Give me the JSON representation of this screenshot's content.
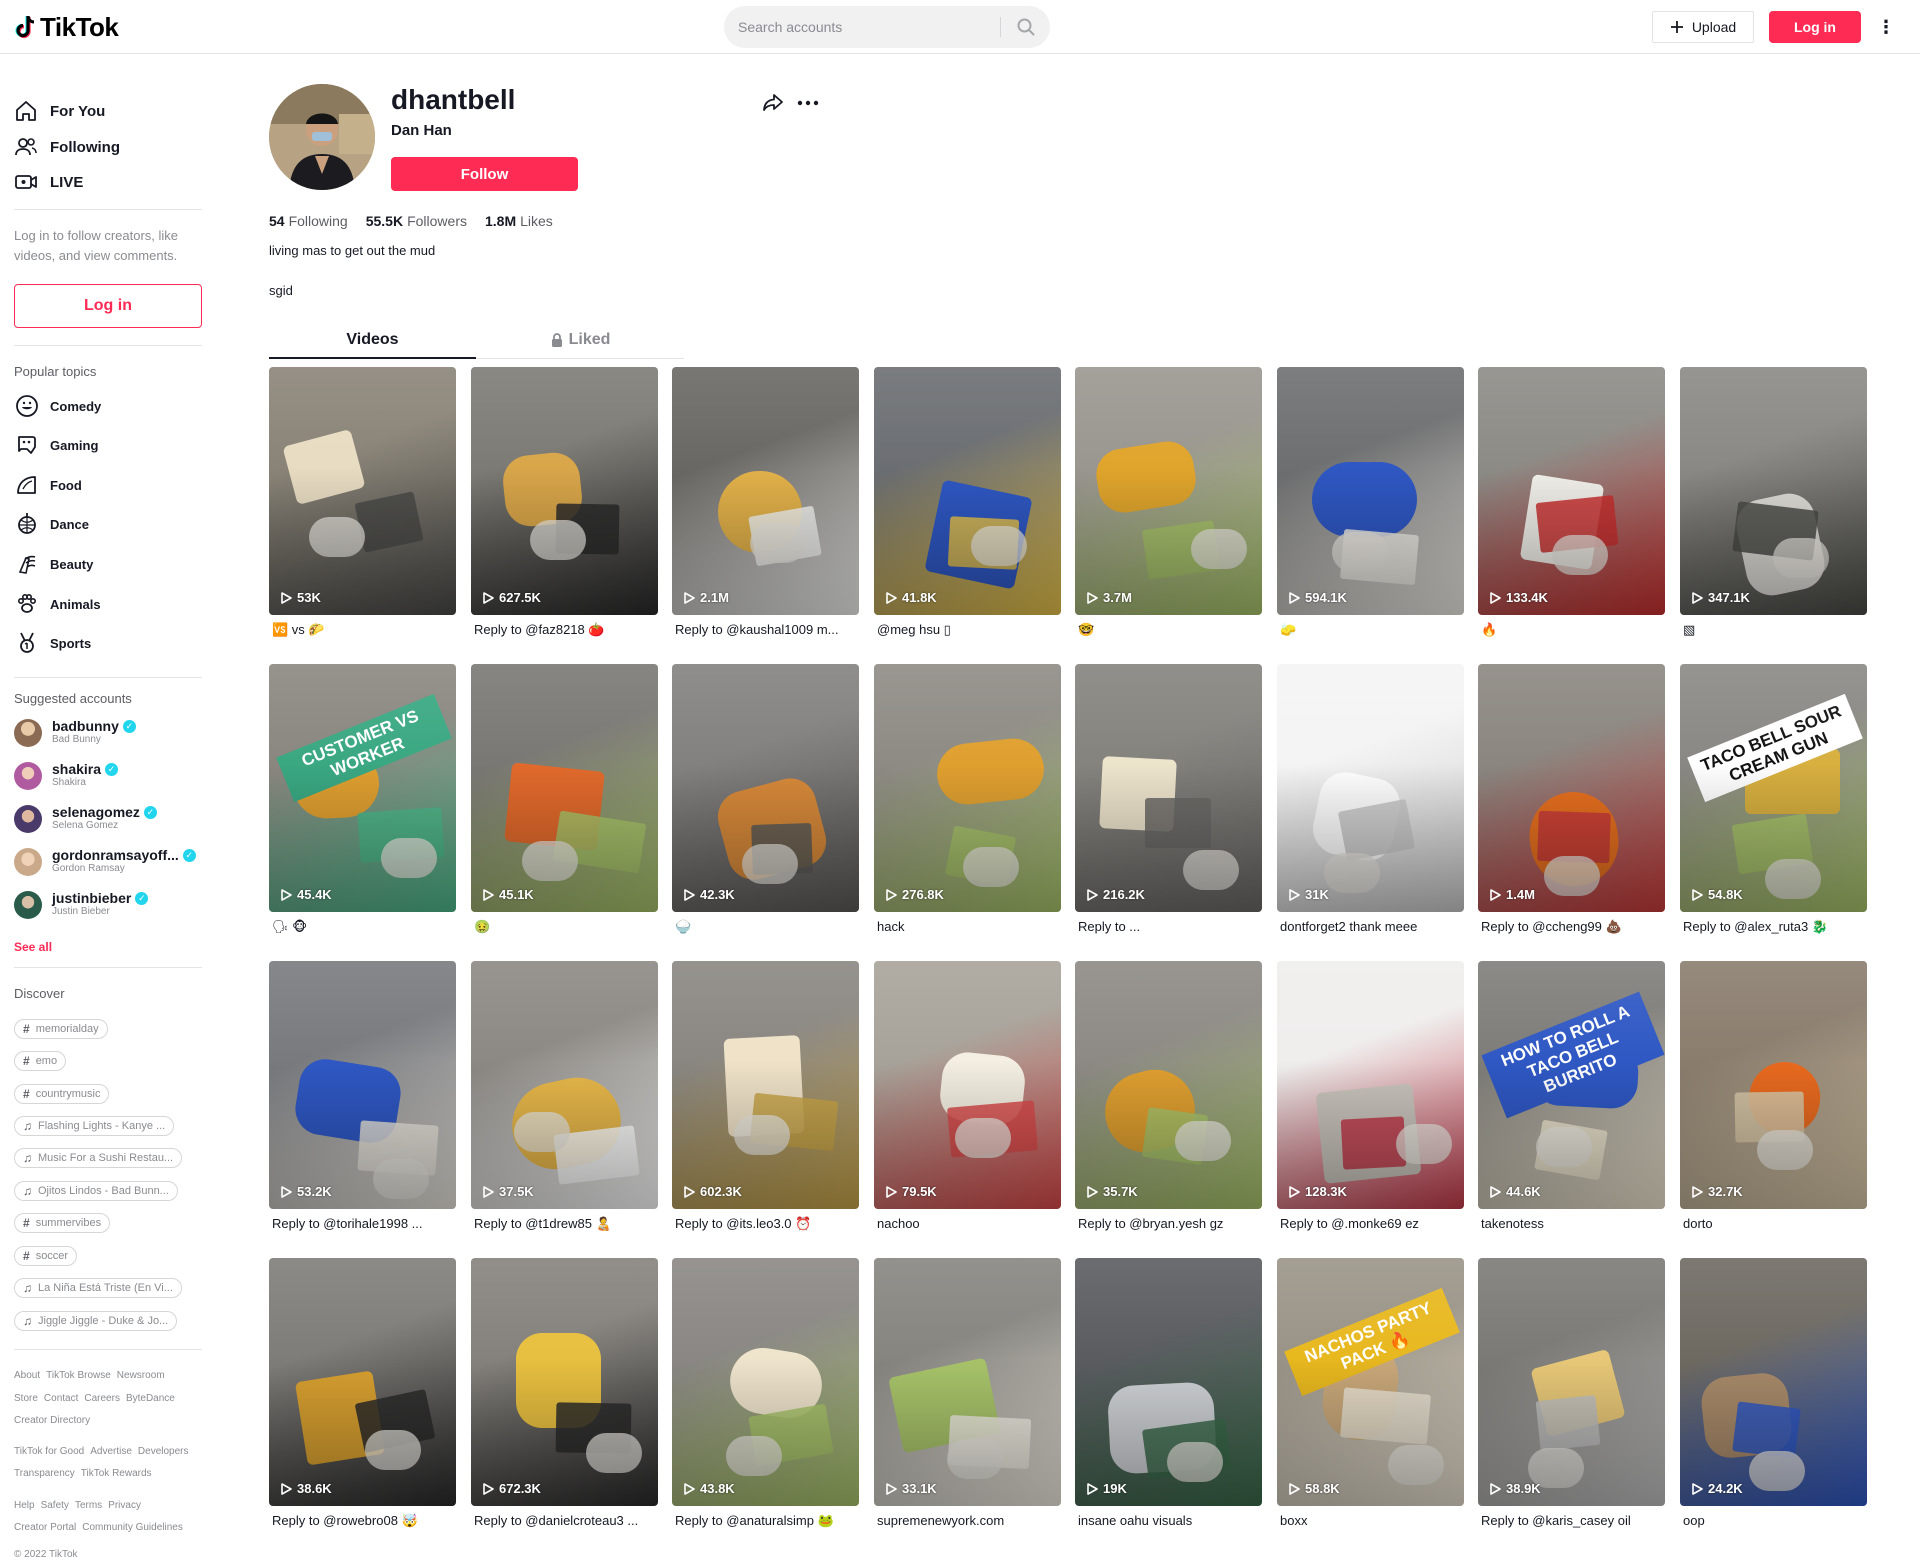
{
  "header": {
    "logo_text": "TikTok",
    "search_placeholder": "Search accounts",
    "upload_label": "Upload",
    "login_label": "Log in"
  },
  "sidebar": {
    "nav": [
      {
        "label": "For You",
        "icon": "home-icon"
      },
      {
        "label": "Following",
        "icon": "users-icon"
      },
      {
        "label": "LIVE",
        "icon": "live-icon"
      }
    ],
    "login_note": "Log in to follow creators, like videos, and view comments.",
    "login_button": "Log in",
    "popular_topics_heading": "Popular topics",
    "topics": [
      {
        "label": "Comedy",
        "icon": "smile-icon"
      },
      {
        "label": "Gaming",
        "icon": "gamepad-icon"
      },
      {
        "label": "Food",
        "icon": "taco-icon"
      },
      {
        "label": "Dance",
        "icon": "disco-ball-icon"
      },
      {
        "label": "Beauty",
        "icon": "lipstick-icon"
      },
      {
        "label": "Animals",
        "icon": "paw-icon"
      },
      {
        "label": "Sports",
        "icon": "medal-icon"
      }
    ],
    "suggested_heading": "Suggested accounts",
    "accounts": [
      {
        "name": "badbunny",
        "sub": "Bad Bunny",
        "color": "#8a6a52"
      },
      {
        "name": "shakira",
        "sub": "Shakira",
        "color": "#b05aa0"
      },
      {
        "name": "selenagomez",
        "sub": "Selena Gomez",
        "color": "#4a3a6a"
      },
      {
        "name": "gordonramsayoff...",
        "sub": "Gordon Ramsay",
        "color": "#c9a98a"
      },
      {
        "name": "justinbieber",
        "sub": "Justin Bieber",
        "color": "#2a5a4a"
      }
    ],
    "see_all": "See all",
    "discover_heading": "Discover",
    "discover": [
      {
        "type": "hashtag",
        "label": "memorialday"
      },
      {
        "type": "hashtag",
        "label": "emo"
      },
      {
        "type": "hashtag",
        "label": "countrymusic"
      },
      {
        "type": "music",
        "label": "Flashing Lights - Kanye ..."
      },
      {
        "type": "music",
        "label": "Music For a Sushi Restau..."
      },
      {
        "type": "music",
        "label": "Ojitos Lindos - Bad Bunn..."
      },
      {
        "type": "hashtag",
        "label": "summervibes"
      },
      {
        "type": "hashtag",
        "label": "soccer"
      },
      {
        "type": "music",
        "label": "La Niña Está Triste (En Vi..."
      },
      {
        "type": "music",
        "label": "Jiggle Jiggle - Duke & Jo..."
      }
    ],
    "footer": [
      [
        "About",
        "TikTok Browse",
        "Newsroom"
      ],
      [
        "Store",
        "Contact",
        "Careers",
        "ByteDance"
      ],
      [
        "Creator Directory"
      ],
      [
        "TikTok for Good",
        "Advertise",
        "Developers"
      ],
      [
        "Transparency",
        "TikTok Rewards"
      ],
      [
        "Help",
        "Safety",
        "Terms",
        "Privacy"
      ],
      [
        "Creator Portal",
        "Community Guidelines"
      ],
      [
        "© 2022 TikTok"
      ]
    ]
  },
  "profile": {
    "username": "dhantbell",
    "nickname": "Dan Han",
    "follow_label": "Follow",
    "following_count": "54",
    "following_label": "Following",
    "followers_count": "55.5K",
    "followers_label": "Followers",
    "likes_count": "1.8M",
    "likes_label": "Likes",
    "bio": "living mas to get out the mud",
    "bio_line2": "sgid"
  },
  "tabs": {
    "videos": "Videos",
    "liked": "Liked"
  },
  "videos": [
    {
      "views": "53K",
      "caption": "🆚 vs 🌮",
      "palette": [
        "#8a8478",
        "#e8dcc2",
        "#4a4a48"
      ]
    },
    {
      "views": "627.5K",
      "caption": "Reply to @faz8218 🍅",
      "palette": [
        "#7d7b75",
        "#d9a64a",
        "#2a2a2a"
      ]
    },
    {
      "views": "2.1M",
      "caption": "Reply to @kaushal1009 m...",
      "palette": [
        "#6a6864",
        "#e3b24a",
        "#f2f2f0"
      ]
    },
    {
      "views": "41.8K",
      "caption": "@meg hsu ▯",
      "palette": [
        "#6b6e72",
        "#2f58c4",
        "#e6c24a"
      ]
    },
    {
      "views": "3.7M",
      "caption": "🤓",
      "palette": [
        "#9a9690",
        "#e0a52c",
        "#a8c46a"
      ]
    },
    {
      "views": "594.1K",
      "caption": "🧽",
      "palette": [
        "#6e6f70",
        "#2f58c4",
        "#f0ede6"
      ]
    },
    {
      "views": "133.4K",
      "caption": "🔥",
      "palette": [
        "#8d8b86",
        "#f2f0ea",
        "#c92f2f"
      ]
    },
    {
      "views": "347.1K",
      "caption": "▧",
      "palette": [
        "#8a8985",
        "#dedcd6",
        "#4a4a46"
      ]
    },
    {
      "views": "45.4K",
      "caption": "🗣 🐵",
      "palette": [
        "#8a8780",
        "#e0a030",
        "#4cb88a"
      ],
      "overlay": "CUSTOMER VS WORKER",
      "overlay_color": "#3aa882"
    },
    {
      "views": "45.1K",
      "caption": "🤢",
      "palette": [
        "#7a7874",
        "#e26a2c",
        "#a8c46a"
      ]
    },
    {
      "views": "42.3K",
      "caption": "🍚",
      "palette": [
        "#838180",
        "#d88a3a",
        "#5c5a58"
      ]
    },
    {
      "views": "276.8K",
      "caption": "hack",
      "palette": [
        "#8e8b85",
        "#e0a030",
        "#a8c46a"
      ]
    },
    {
      "views": "216.2K",
      "caption": "Reply to ...",
      "palette": [
        "#85837e",
        "#ede4cc",
        "#6a6866"
      ]
    },
    {
      "views": "31K",
      "caption": "dontforget2 thank meee",
      "palette": [
        "#f4f4f4",
        "#ffffff",
        "#c8c8c8"
      ]
    },
    {
      "views": "1.4M",
      "caption": "Reply to @ccheng99 💩",
      "palette": [
        "#8b8680",
        "#e8701f",
        "#c83a3a"
      ]
    },
    {
      "views": "54.8K",
      "caption": "Reply to @alex_ruta3 🐉",
      "palette": [
        "#8a8884",
        "#d8b040",
        "#a8c46a"
      ],
      "overlay": "TACO BELL SOUR CREAM GUN",
      "overlay_color": "#ffffff"
    },
    {
      "views": "53.2K",
      "caption": "Reply to @torihale1998 ...",
      "palette": [
        "#787a7e",
        "#2f58c4",
        "#e8e4dc"
      ]
    },
    {
      "views": "37.5K",
      "caption": "Reply to @t1drew85 🧑‍🍼",
      "palette": [
        "#8c8984",
        "#e8b84a",
        "#ffffff"
      ]
    },
    {
      "views": "602.3K",
      "caption": "Reply to @its.leo3.0 ⏰",
      "palette": [
        "#8a8782",
        "#efe2c8",
        "#c8a448"
      ]
    },
    {
      "views": "79.5K",
      "caption": "nachoo",
      "palette": [
        "#a8a39a",
        "#f4efe2",
        "#d84a4a"
      ]
    },
    {
      "views": "35.7K",
      "caption": "Reply to @bryan.yesh gz",
      "palette": [
        "#8d8a85",
        "#e0a030",
        "#a8c46a"
      ]
    },
    {
      "views": "128.3K",
      "caption": "Reply to @.monke69 ez",
      "palette": [
        "#efeeed",
        "#c9c4bc",
        "#c23a4a"
      ]
    },
    {
      "views": "44.6K",
      "caption": "takenotess",
      "palette": [
        "#7f7d79",
        "#2f58c4",
        "#efe6d0"
      ],
      "overlay": "HOW TO ROLL A TACO BELL BURRITO",
      "overlay_color": "#2f58c4"
    },
    {
      "views": "32.7K",
      "caption": "dorto",
      "palette": [
        "#8a7d6e",
        "#e86a1f",
        "#d8c8a8"
      ]
    },
    {
      "views": "38.6K",
      "caption": "Reply to @rowebro08 🤯",
      "palette": [
        "#7f7d79",
        "#d8a030",
        "#2a2a2a"
      ]
    },
    {
      "views": "672.3K",
      "caption": "Reply to @danielcroteau3 ...",
      "palette": [
        "#85827d",
        "#e8c040",
        "#2a2a2a"
      ]
    },
    {
      "views": "43.8K",
      "caption": "Reply to @anaturalsimp 🐸",
      "palette": [
        "#8a8784",
        "#efe4cc",
        "#a8c46a"
      ]
    },
    {
      "views": "33.1K",
      "caption": "supremenewyork.com",
      "palette": [
        "#878580",
        "#a8c46a",
        "#f0ece2"
      ]
    },
    {
      "views": "19K",
      "caption": "insane oahu visuals",
      "palette": [
        "#5a5c60",
        "#cfd2d6",
        "#3a6a4a"
      ]
    },
    {
      "views": "58.8K",
      "caption": "boxx",
      "palette": [
        "#9a9488",
        "#c9a87a",
        "#e8e0d0"
      ],
      "overlay": "NACHOS PARTY PACK 🔥",
      "overlay_color": "#e8b81f"
    },
    {
      "views": "38.9K",
      "caption": "Reply to @karis_casey oil",
      "palette": [
        "#7c7a76",
        "#e8c878",
        "#c0c0c0"
      ]
    },
    {
      "views": "24.2K",
      "caption": "oop",
      "palette": [
        "#6e6a62",
        "#a88a6a",
        "#2f58c4"
      ]
    }
  ]
}
